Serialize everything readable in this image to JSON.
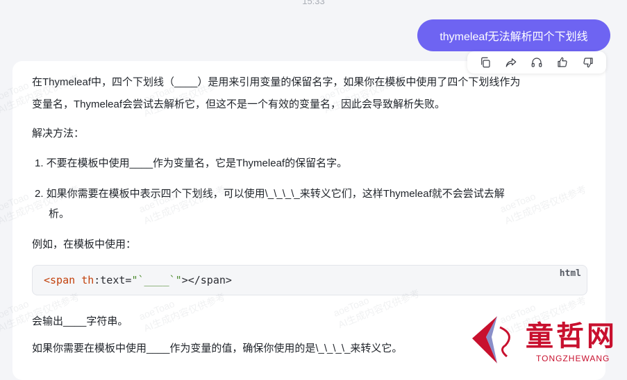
{
  "header": {
    "time": "15:33"
  },
  "user_message": {
    "text": "thymeleaf无法解析四个下划线"
  },
  "action_bar": {
    "icons": [
      "copy-icon",
      "share-icon",
      "headphones-icon",
      "thumbs-up-icon",
      "thumbs-down-icon"
    ]
  },
  "answer": {
    "p1_line1": "在Thymeleaf中，四个下划线（____）是用来引用变量的保留名字，如果你在模板中使用了四个下划线作为",
    "p1_line2": "变量名，Thymeleaf会尝试去解析它，但这不是一个有效的变量名，因此会导致解析失败。",
    "solution_heading": "解决方法：",
    "item1": "1. 不要在模板中使用____作为变量名，它是Thymeleaf的保留名字。",
    "item2_line1": "2. 如果你需要在模板中表示四个下划线，可以使用\\_\\_\\_\\_来转义它们，这样Thymeleaf就不会尝试去解",
    "item2_line2": "析。",
    "example_label": "例如，在模板中使用：",
    "code": {
      "lang": "html",
      "tag_open": "<span ",
      "attr": "th",
      "colon_text": ":text=",
      "string": "\"`____`\"",
      "tag_close": "></span>"
    },
    "output_line": "会输出____字符串。",
    "final_line": "如果你需要在模板中使用____作为变量的值，确保你使用的是\\_\\_\\_\\_来转义它。"
  },
  "watermark": {
    "line1": "aoeToao",
    "line2": "AI生成内容仅供参考"
  },
  "logo": {
    "text": "童哲网",
    "subtitle": "TONGZHEWANG"
  },
  "colors": {
    "accent": "#6e64f2",
    "logo_red": "#c8102e"
  }
}
